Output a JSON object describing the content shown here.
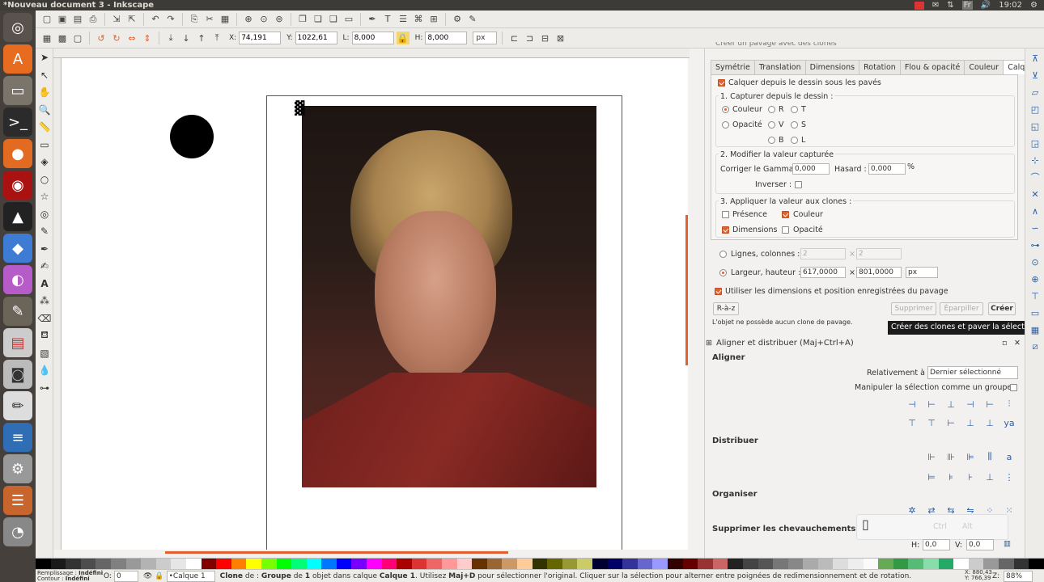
{
  "window": {
    "title": "*Nouveau document 3 - Inkscape"
  },
  "tray": {
    "lang": "Fr",
    "time": "19:02"
  },
  "launcher": [
    "ubuntu-icon",
    "software-center-icon",
    "files-icon",
    "terminal-icon",
    "firefox-icon",
    "record-icon",
    "inkscape-icon",
    "blender-icon",
    "color-icon",
    "gimp-icon",
    "presentation-icon",
    "screenshot-icon",
    "text-editor-icon",
    "writer-icon",
    "settings-icon",
    "stack-icon",
    "disk-icon"
  ],
  "toolbar2": {
    "x_label": "X:",
    "x_value": "74,191",
    "y_label": "Y:",
    "y_value": "1022,61",
    "l_label": "L:",
    "l_value": "8,000",
    "h_label": "H:",
    "h_value": "8,000",
    "unit": "px"
  },
  "clone_dialog": {
    "title": "Créer un pavage avec des clones",
    "tabs": [
      "Symétrie",
      "Translation",
      "Dimensions",
      "Rotation",
      "Flou & opacité",
      "Couleur",
      "Calquer"
    ],
    "active_tab": "Calquer",
    "trace_checkbox": "Calquer depuis le dessin sous les pavés",
    "section1": "1. Capturer depuis le dessin :",
    "r_couleur": "Couleur",
    "r_r": "R",
    "r_t": "T",
    "r_opacite": "Opacité",
    "r_v": "V",
    "r_s": "S",
    "r_b": "B",
    "r_l": "L",
    "section2": "2. Modifier la valeur capturée",
    "gamma_label": "Corriger le Gamma",
    "gamma_value": "0,000",
    "hasard_label": "Hasard :",
    "hasard_value": "0,000",
    "percent": "%",
    "inverser_label": "Inverser :",
    "section3": "3. Appliquer la valeur aux clones :",
    "cb_presence": "Présence",
    "cb_couleur": "Couleur",
    "cb_dimensions": "Dimensions",
    "cb_opacite": "Opacité",
    "rows_cols_label": "Lignes, colonnes :",
    "rows_value": "2",
    "cols_value": "2",
    "times": "×",
    "wh_label": "Largeur, hauteur :",
    "width_value": "617,0000",
    "height_value": "801,0000",
    "wh_unit": "px",
    "use_saved_label": "Utiliser les dimensions et position enregistrées du pavage",
    "reset_button": "R-à-z",
    "remove_button": "Supprimer",
    "scatter_button": "Éparpiller",
    "create_button": "Créer",
    "info_text": "L'objet ne possède aucun clone de pavage.",
    "tooltip": "Créer des clones et paver la sélection avec"
  },
  "align_dialog": {
    "title": "Aligner et distribuer (Maj+Ctrl+A)",
    "aligner": "Aligner",
    "relative_label": "Relativement à :",
    "relative_value": "Dernier sélectionné",
    "group_label": "Manipuler la sélection comme un groupe :",
    "distribuer": "Distribuer",
    "organiser": "Organiser",
    "overlap": "Supprimer les chevauchements",
    "h_label": "H:",
    "h_value": "0,0",
    "v_label": "V:",
    "v_value": "0,0"
  },
  "keys_overlay": {
    "ctrl": "Ctrl",
    "alt": "Alt"
  },
  "statusbar": {
    "fill_label": "Remplissage :",
    "fill_value": "Indéfini",
    "stroke_label": "Contour :",
    "stroke_value": "Indéfini",
    "opacity_label": "O:",
    "opacity_value": "0",
    "layer": "•Calque 1",
    "message_bold1": "Clone",
    "message_mid1": " de : ",
    "message_bold2": "Groupe",
    "message_mid2": " de ",
    "message_bold3": "1",
    "message_mid3": " objet dans calque ",
    "message_bold4": "Calque 1",
    "message_mid4": ". Utilisez ",
    "message_bold5": "Maj+D",
    "message_rest": " pour sélectionner l'original. Cliquer sur la sélection pour alterner entre poignées de redimensionnement et de rotation.",
    "cursor_x_label": "X:",
    "cursor_x": "880,43",
    "cursor_y_label": "Y:",
    "cursor_y": "766,39",
    "zoom_label": "Z:",
    "zoom": "88%"
  },
  "colors": {
    "accent": "#e0602e",
    "panel": "#f2f1f0",
    "launcher": "#45403c",
    "topbar": "#3c3b37"
  }
}
